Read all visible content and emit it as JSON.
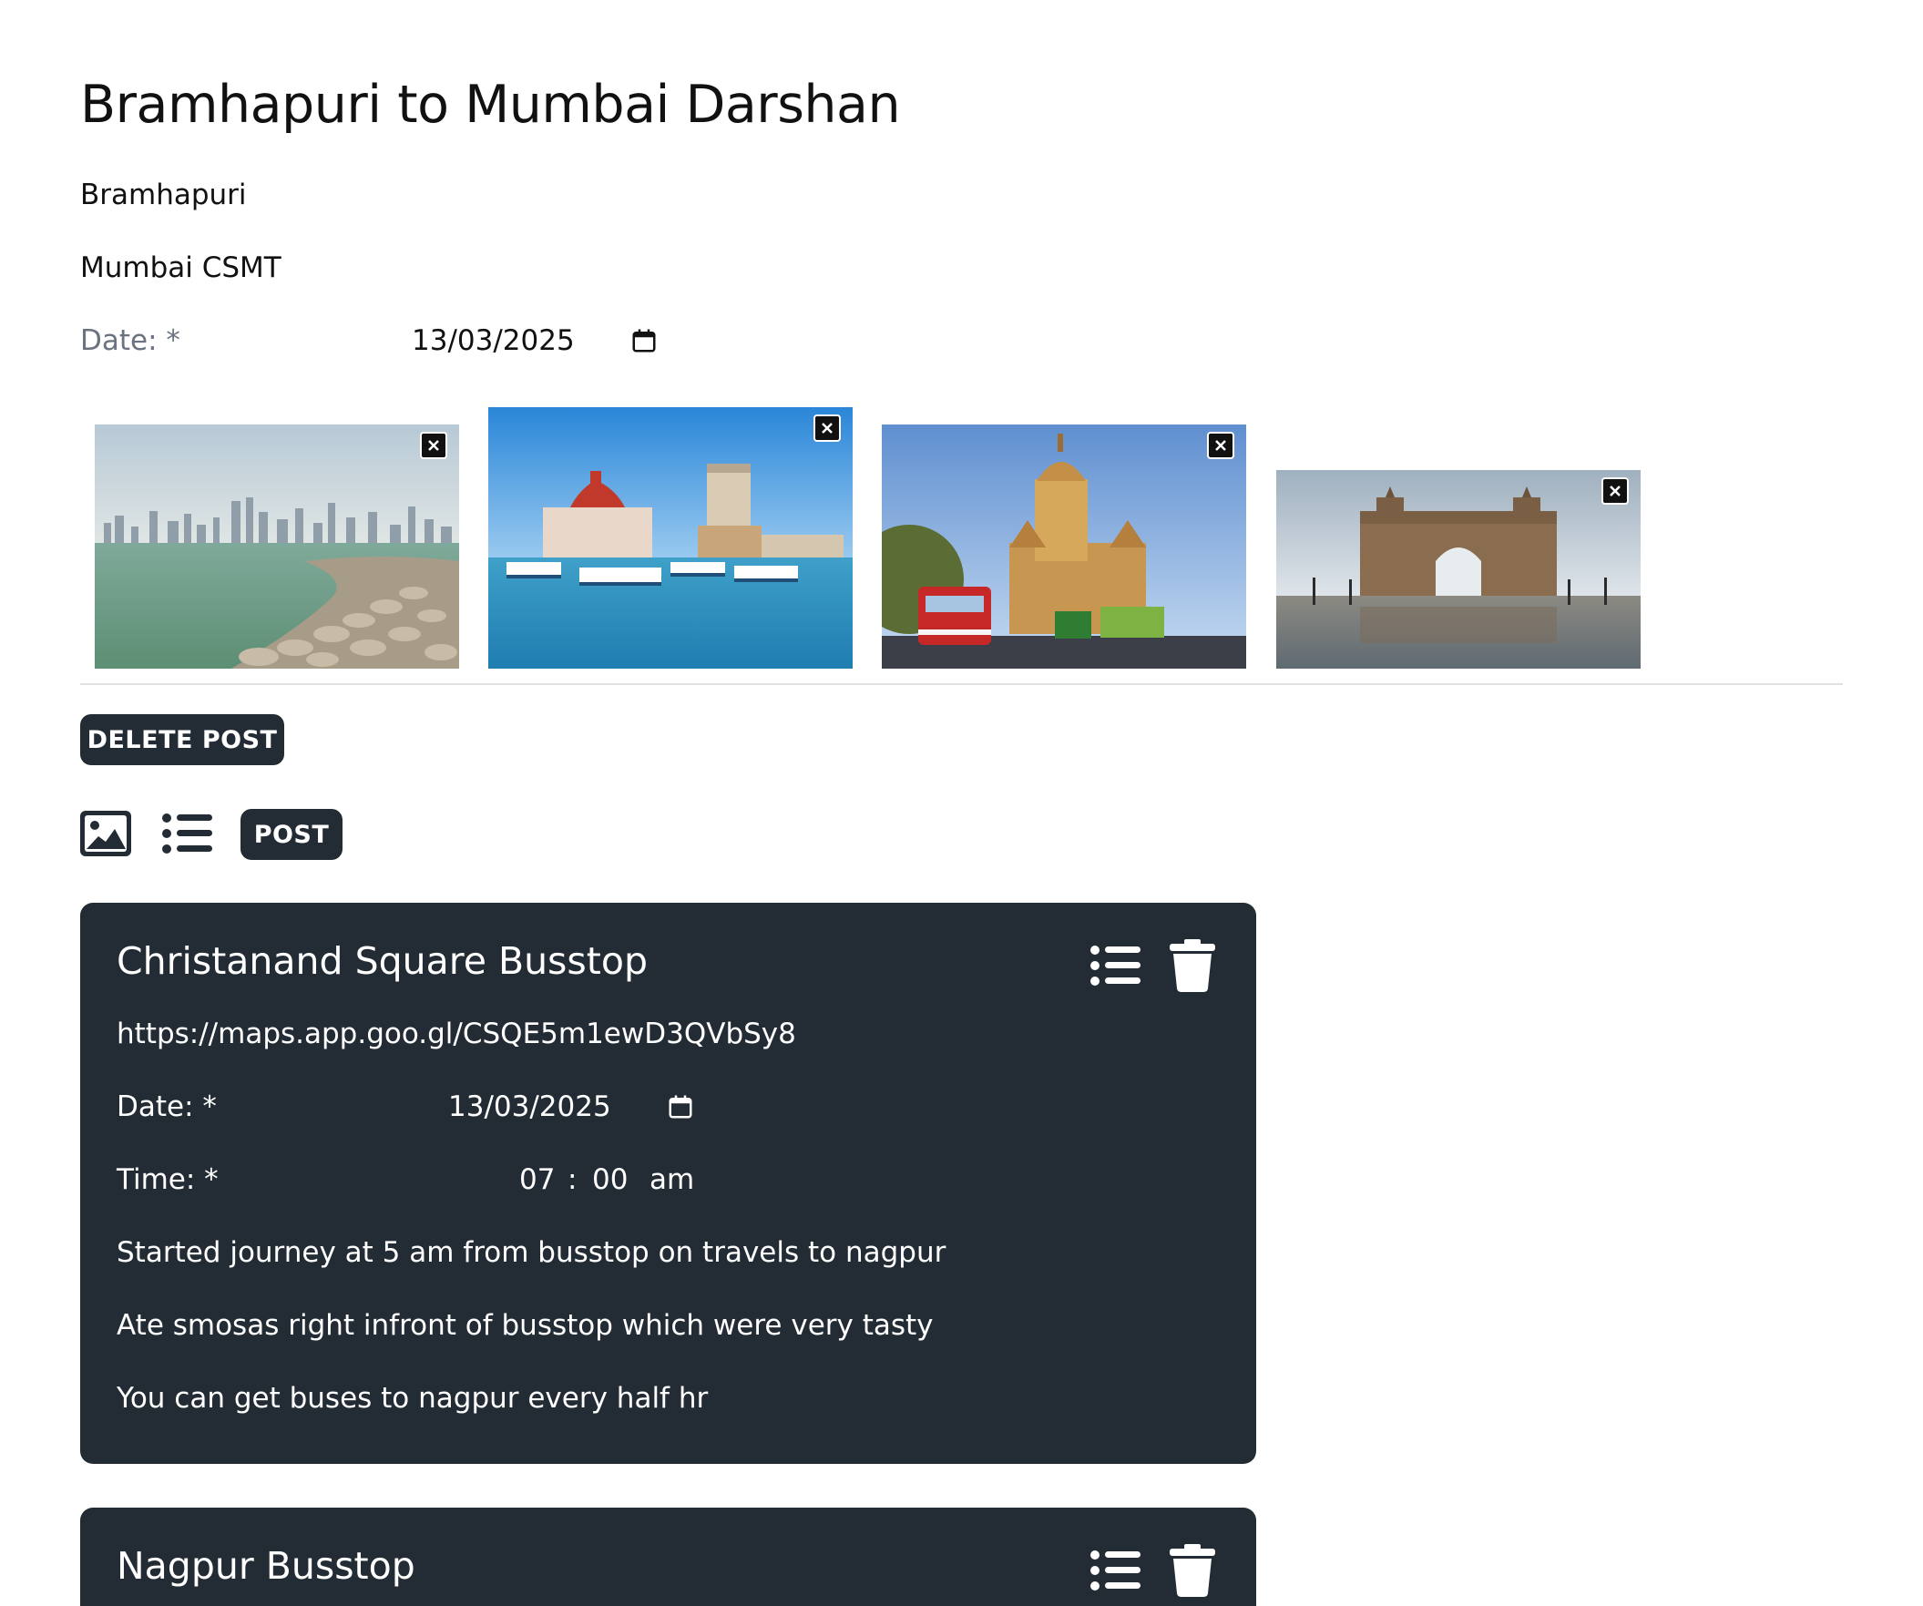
{
  "post": {
    "title": "Bramhapuri to Mumbai Darshan",
    "from": "Bramhapuri",
    "to": "Mumbai CSMT",
    "date_label": "Date: *",
    "date_value": "13/03/2025"
  },
  "images": [
    {
      "alt": "Mumbai skyline from Marine Drive",
      "remove_label": "×"
    },
    {
      "alt": "Taj Mahal Palace hotel and Gateway of India from the sea",
      "remove_label": "×"
    },
    {
      "alt": "BMC Headquarters building with red bus",
      "remove_label": "×"
    },
    {
      "alt": "Gateway of India",
      "remove_label": "×"
    }
  ],
  "actions": {
    "delete_post": "DELETE POST",
    "post": "POST"
  },
  "stops": [
    {
      "title": "Christanand Square Busstop",
      "link": "https://maps.app.goo.gl/CSQE5m1ewD3QVbSy8",
      "date_label": "Date: *",
      "date_value": "13/03/2025",
      "time_label": "Time: *",
      "time_hour": "07",
      "time_sep": ":",
      "time_min": "00",
      "time_ampm": "am",
      "notes": [
        "Started journey at 5 am from busstop on travels to nagpur",
        "Ate smosas right infront of busstop which were very tasty",
        "You can get buses to nagpur every half hr"
      ]
    },
    {
      "title": "Nagpur Busstop"
    }
  ],
  "colors": {
    "dark": "#232c35",
    "muted_label": "#6b7280",
    "divider": "#dfe1e3"
  }
}
